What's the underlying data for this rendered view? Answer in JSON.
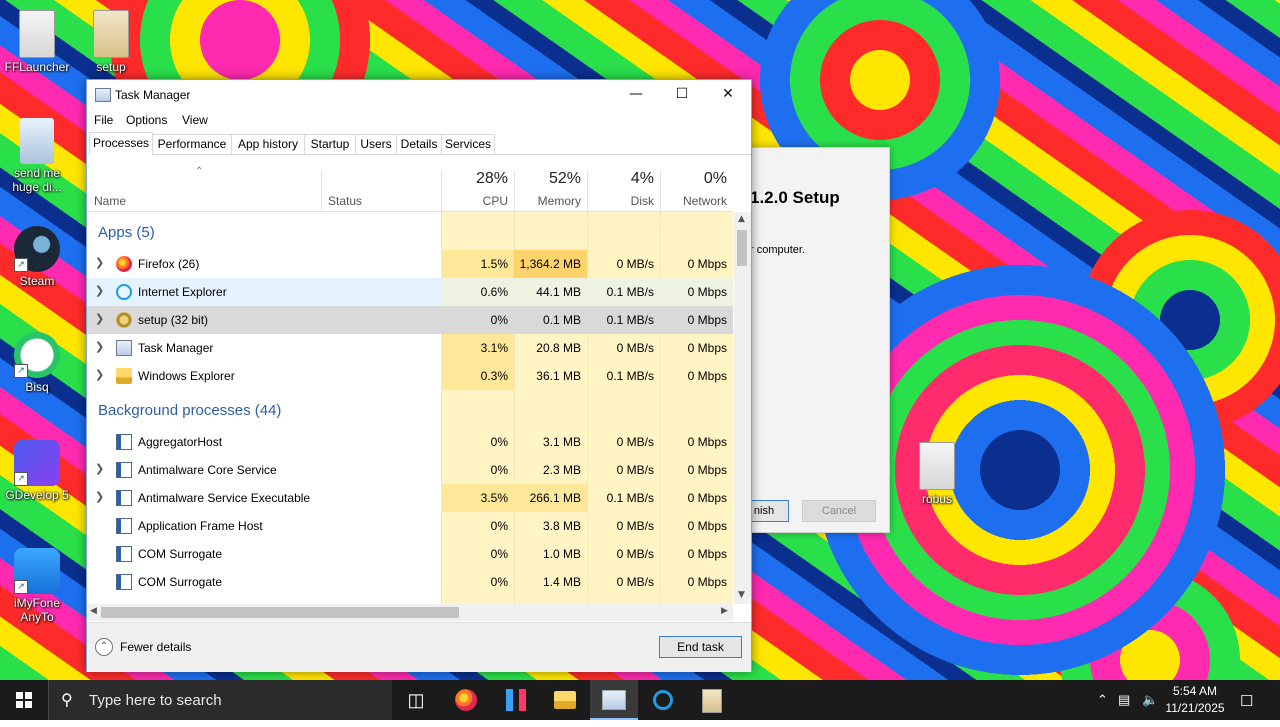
{
  "desktop": {
    "icons": [
      {
        "label": "FFLauncher"
      },
      {
        "label": "setup"
      },
      {
        "label": "send me huge di..."
      },
      {
        "label": "Steam"
      },
      {
        "label": "Bisq"
      },
      {
        "label": "GDevelop 5"
      },
      {
        "label": "iMyFone AnyTo"
      },
      {
        "label": "robus"
      }
    ]
  },
  "setup_window": {
    "title": "1.2.0 Setup",
    "subtitle": "r computer.",
    "finish_label": "nish",
    "cancel_label": "Cancel"
  },
  "task_manager": {
    "title": "Task Manager",
    "menu": [
      "File",
      "Options",
      "View"
    ],
    "tabs": [
      "Processes",
      "Performance",
      "App history",
      "Startup",
      "Users",
      "Details",
      "Services"
    ],
    "active_tab": "Processes",
    "columns": {
      "name": "Name",
      "status": "Status",
      "cpu": {
        "pct": "28%",
        "label": "CPU"
      },
      "memory": {
        "pct": "52%",
        "label": "Memory"
      },
      "disk": {
        "pct": "4%",
        "label": "Disk"
      },
      "network": {
        "pct": "0%",
        "label": "Network"
      }
    },
    "groups": {
      "apps": "Apps (5)",
      "background": "Background processes (44)"
    },
    "apps": [
      {
        "name": "Firefox (26)",
        "cpu": "1.5%",
        "memory": "1,364.2 MB",
        "disk": "0 MB/s",
        "network": "0 Mbps",
        "icon": "firefox-icon"
      },
      {
        "name": "Internet Explorer",
        "cpu": "0.6%",
        "memory": "44.1 MB",
        "disk": "0.1 MB/s",
        "network": "0 Mbps",
        "icon": "internet-explorer-icon"
      },
      {
        "name": "setup (32 bit)",
        "cpu": "0%",
        "memory": "0.1 MB",
        "disk": "0.1 MB/s",
        "network": "0 Mbps",
        "icon": "setup-icon"
      },
      {
        "name": "Task Manager",
        "cpu": "3.1%",
        "memory": "20.8 MB",
        "disk": "0 MB/s",
        "network": "0 Mbps",
        "icon": "task-manager-icon"
      },
      {
        "name": "Windows Explorer",
        "cpu": "0.3%",
        "memory": "36.1 MB",
        "disk": "0.1 MB/s",
        "network": "0 Mbps",
        "icon": "folder-icon"
      }
    ],
    "background": [
      {
        "name": "AggregatorHost",
        "cpu": "0%",
        "memory": "3.1 MB",
        "disk": "0 MB/s",
        "network": "0 Mbps",
        "expandable": false
      },
      {
        "name": "Antimalware Core Service",
        "cpu": "0%",
        "memory": "2.3 MB",
        "disk": "0 MB/s",
        "network": "0 Mbps",
        "expandable": true
      },
      {
        "name": "Antimalware Service Executable",
        "cpu": "3.5%",
        "memory": "266.1 MB",
        "disk": "0.1 MB/s",
        "network": "0 Mbps",
        "expandable": true
      },
      {
        "name": "Application Frame Host",
        "cpu": "0%",
        "memory": "3.8 MB",
        "disk": "0 MB/s",
        "network": "0 Mbps",
        "expandable": false
      },
      {
        "name": "COM Surrogate",
        "cpu": "0%",
        "memory": "1.0 MB",
        "disk": "0 MB/s",
        "network": "0 Mbps",
        "expandable": false
      },
      {
        "name": "COM Surrogate",
        "cpu": "0%",
        "memory": "1.4 MB",
        "disk": "0 MB/s",
        "network": "0 Mbps",
        "expandable": false
      }
    ],
    "footer": {
      "fewer_details": "Fewer details",
      "end_task": "End task"
    }
  },
  "taskbar": {
    "search_placeholder": "Type here to search",
    "time": "5:54 AM",
    "date": "11/21/2025"
  },
  "colors": {
    "heat_light": "#fff4c4",
    "heat_mid": "#ffe79a",
    "heat_high": "#ffd36b",
    "hover_row": "#e5f3ff",
    "selected_row": "#d9d9d9",
    "group_blue": "#2d5fa8"
  }
}
